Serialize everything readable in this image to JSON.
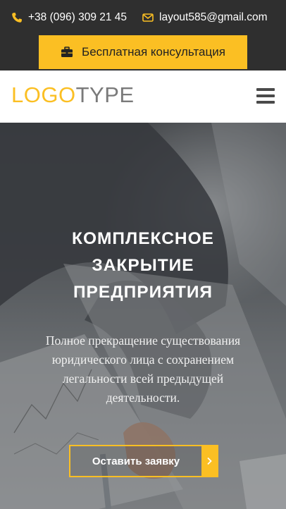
{
  "topbar": {
    "phone": "+38 (096) 309 21 45",
    "email": "layout585@gmail.com",
    "consult_label": "Бесплатная консультация"
  },
  "header": {
    "logo_part1": "LOGO",
    "logo_part2": "TYPE"
  },
  "hero": {
    "title_lines": [
      "КОМПЛЕКСНОЕ",
      "ЗАКРЫТИЕ",
      "ПРЕДПРИЯТИЯ"
    ],
    "text_lines": [
      "Полное прекращение существования",
      "юридического лица с сохранением",
      "легальности всей предыдущей",
      "деятельности."
    ],
    "button_label": "Оставить заявку"
  },
  "colors": {
    "accent": "#fbbf23",
    "topbar_bg": "#2f2f2f",
    "header_bg": "#ffffff"
  },
  "icons": {
    "phone": "phone-icon",
    "email": "envelope-icon",
    "consult": "briefcase-icon",
    "menu": "hamburger-icon",
    "button_arrow": "chevron-right-icon"
  }
}
